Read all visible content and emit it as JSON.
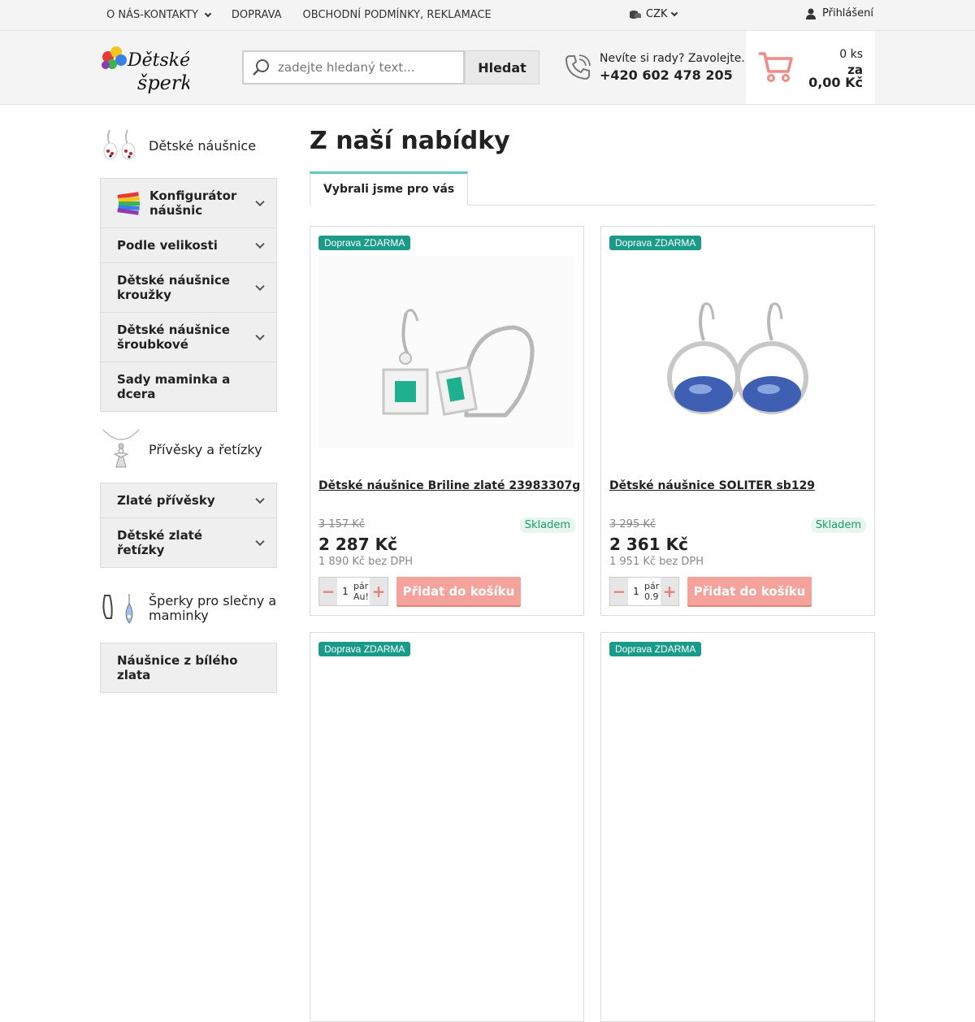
{
  "topnav": {
    "items": [
      {
        "label": "O NÁS-KONTAKTY",
        "has_dropdown": true
      },
      {
        "label": "DOPRAVA",
        "has_dropdown": false
      },
      {
        "label": "OBCHODNÍ PODMÍNKY, REKLAMACE",
        "has_dropdown": false
      }
    ],
    "currency": "CZK",
    "login": "Přihlášení"
  },
  "header": {
    "search_placeholder": "zadejte hledaný text...",
    "search_button": "Hledat",
    "phone_question": "Nevíte si rady? Zavolejte.",
    "phone_number": "+420 602 478 205",
    "cart_qty": "0 ks",
    "cart_za": "za",
    "cart_sum": "0,00 Kč",
    "accent": "#e8807a"
  },
  "sidebar": {
    "sections": [
      {
        "title": "Dětské náušnice",
        "items": [
          {
            "label": "Konfigurátor náušnic",
            "chevron": true,
            "icon": true
          },
          {
            "label": "Podle velikosti",
            "chevron": true
          },
          {
            "label": "Dětské náušnice kroužky",
            "chevron": true
          },
          {
            "label": "Dětské náušnice šroubkové",
            "chevron": true
          },
          {
            "label": "Sady maminka a dcera",
            "chevron": false
          }
        ]
      },
      {
        "title": "Přívěsky a řetízky",
        "items": [
          {
            "label": "Zlaté přívěsky",
            "chevron": true
          },
          {
            "label": "Dětské zlaté řetízky",
            "chevron": true
          }
        ]
      },
      {
        "title": "Šperky pro slečny a maminky",
        "items": [
          {
            "label": "Náušnice z bílého zlata",
            "chevron": false
          }
        ]
      }
    ]
  },
  "main": {
    "heading": "Z naší nabídky",
    "tab": "Vybrali jsme pro vás",
    "products": [
      {
        "badge": "Doprava ZDARMA",
        "name": "Dětské náušnice Briline zlaté 23983307g",
        "old_price": "3 157 Kč",
        "stock": "Skladem",
        "price": "2 287 Kč",
        "price_novat": "1 890 Kč bez DPH",
        "qty": "1",
        "unit": "pár Au!",
        "add": "Přidat do košíku",
        "image": "emerald-earrings"
      },
      {
        "badge": "Doprava ZDARMA",
        "name": "Dětské náušnice SOLITER sb129",
        "old_price": "3 295 Kč",
        "stock": "Skladem",
        "price": "2 361 Kč",
        "price_novat": "1 951 Kč bez DPH",
        "qty": "1",
        "unit": "pár 0.9",
        "add": "Přidat do košíku",
        "image": "sapphire-earrings"
      },
      {
        "badge": "Doprava ZDARMA"
      },
      {
        "badge": "Doprava ZDARMA"
      }
    ]
  }
}
